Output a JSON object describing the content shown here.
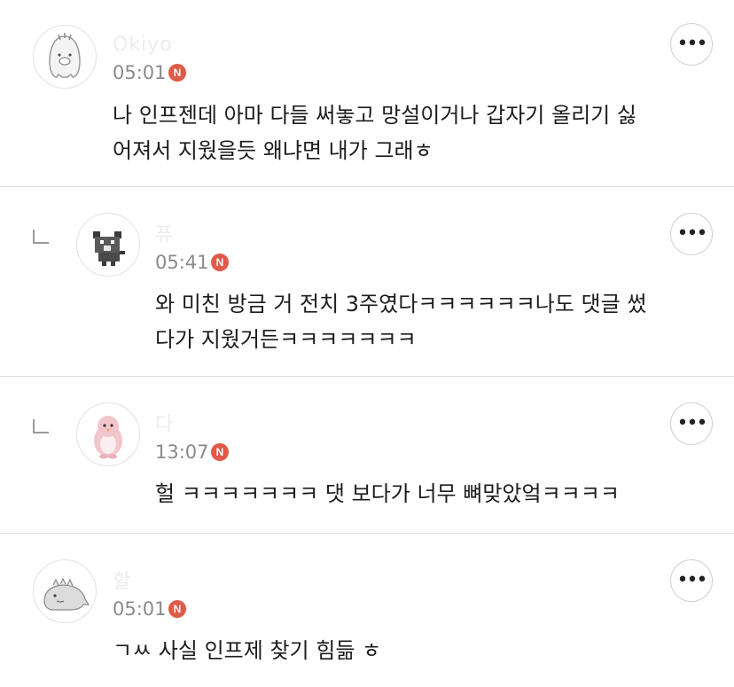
{
  "comments": [
    {
      "author": "Okiyo",
      "time": "05:01",
      "badge": "N",
      "text": "나 인프젠데 아마 다들 써놓고 망설이거나 갑자기 올리기 싫\n어져서 지웠을듯 왜냐면 내가 그래ㅎ",
      "is_reply": false,
      "avatar_icon": "ghost-character-icon"
    },
    {
      "author": "퓨",
      "time": "05:41",
      "badge": "N",
      "text": "와 미친 방금 거 전치 3주였다ㅋㅋㅋㅋㅋㅋ나도 댓글 썼\n다가 지웠거든ㅋㅋㅋㅋㅋㅋㅋ",
      "is_reply": true,
      "avatar_icon": "pixel-cat-icon"
    },
    {
      "author": "다",
      "time": "13:07",
      "badge": "N",
      "text": "헐 ㅋㅋㅋㅋㅋㅋㅋ 댓 보다가 너무 뼈맞았엌ㅋㅋㅋㅋ",
      "is_reply": true,
      "avatar_icon": "pink-penguin-icon"
    },
    {
      "author": "할",
      "time": "05:01",
      "badge": "N",
      "text": "ㄱㅆ 사실 인프제 찾기 힘듦 ㅎ",
      "is_reply": false,
      "avatar_icon": "dinosaur-icon"
    }
  ],
  "more_label": "•••",
  "colors": {
    "badge": "#e05a47",
    "divider": "#dcdcdc",
    "time": "#8a8a8a"
  }
}
